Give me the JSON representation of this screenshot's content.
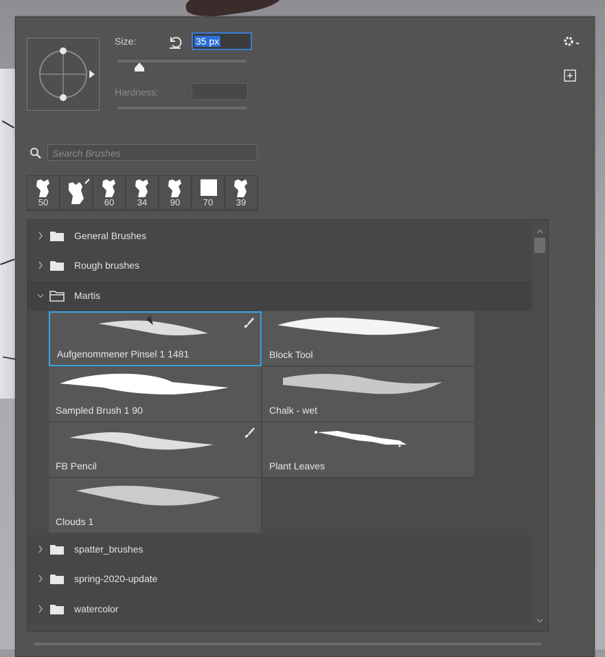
{
  "size": {
    "label": "Size:",
    "value": "35 px",
    "slider_fraction": 0.17
  },
  "hardness": {
    "label": "Hardness:",
    "value": ""
  },
  "search": {
    "placeholder": "Search Brushes"
  },
  "recent_brushes": [
    {
      "size": "50"
    },
    {
      "size": ""
    },
    {
      "size": "60"
    },
    {
      "size": "34"
    },
    {
      "size": "90"
    },
    {
      "size": "70"
    },
    {
      "size": "39"
    }
  ],
  "folders_top": [
    {
      "name": "General Brushes",
      "open": false
    },
    {
      "name": "Rough brushes",
      "open": false
    },
    {
      "name": "Martis",
      "open": true
    }
  ],
  "brushes": [
    {
      "name": "Aufgenommener Pinsel 1 1481",
      "selected": true,
      "has_brush_icon": true
    },
    {
      "name": "Block Tool",
      "selected": false,
      "has_brush_icon": false
    },
    {
      "name": "Sampled Brush 1 90",
      "selected": false,
      "has_brush_icon": false
    },
    {
      "name": "Chalk - wet",
      "selected": false,
      "has_brush_icon": false
    },
    {
      "name": "FB Pencil",
      "selected": false,
      "has_brush_icon": true
    },
    {
      "name": "Plant Leaves",
      "selected": false,
      "has_brush_icon": false
    },
    {
      "name": "Clouds 1",
      "selected": false,
      "has_brush_icon": false
    }
  ],
  "folders_bottom": [
    {
      "name": "spatter_brushes",
      "open": false
    },
    {
      "name": "spring-2020-update",
      "open": false
    },
    {
      "name": "watercolor",
      "open": false
    }
  ],
  "colors": {
    "panel": "#535353",
    "accent": "#3aa3e0",
    "input_focus": "#3a7fd0"
  },
  "icons": [
    "reset-icon",
    "gear-icon",
    "new-preset-icon",
    "search-icon",
    "folder-icon",
    "chevron-right-icon",
    "chevron-down-icon",
    "brush-icon"
  ]
}
